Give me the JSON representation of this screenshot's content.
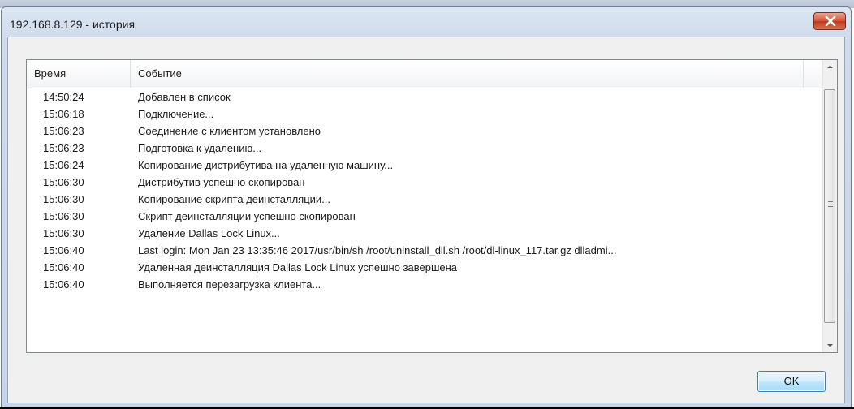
{
  "window": {
    "title": "192.168.8.129 - история"
  },
  "columns": {
    "time": "Время",
    "event": "Событие"
  },
  "rows": [
    {
      "time": "14:50:24",
      "event": "Добавлен в список"
    },
    {
      "time": "15:06:18",
      "event": "Подключение..."
    },
    {
      "time": "15:06:23",
      "event": "Соединение с клиентом установлено"
    },
    {
      "time": "15:06:23",
      "event": "Подготовка к удалению..."
    },
    {
      "time": "15:06:24",
      "event": "Копирование дистрибутива на удаленную машину..."
    },
    {
      "time": "15:06:30",
      "event": "Дистрибутив успешно скопирован"
    },
    {
      "time": "15:06:30",
      "event": "Копирование скрипта деинсталляции..."
    },
    {
      "time": "15:06:30",
      "event": "Скрипт деинсталляции успешно скопирован"
    },
    {
      "time": "15:06:30",
      "event": "Удаление Dallas Lock Linux..."
    },
    {
      "time": "15:06:40",
      "event": "Last login: Mon Jan 23 13:35:46 2017/usr/bin/sh /root/uninstall_dll.sh /root/dl-linux_117.tar.gz dlladmi..."
    },
    {
      "time": "15:06:40",
      "event": "Удаленная деинсталляция Dallas Lock Linux успешно завершена"
    },
    {
      "time": "15:06:40",
      "event": "Выполняется перезагрузка клиента..."
    }
  ],
  "buttons": {
    "ok": "OK"
  },
  "icons": {
    "close": "close-icon",
    "scroll_up": "arrow-up-icon",
    "scroll_down": "arrow-down-icon"
  },
  "colors": {
    "close_button": "#c2381c",
    "ok_border": "#3c7fb1",
    "window_frame": "#cfdbeb"
  }
}
